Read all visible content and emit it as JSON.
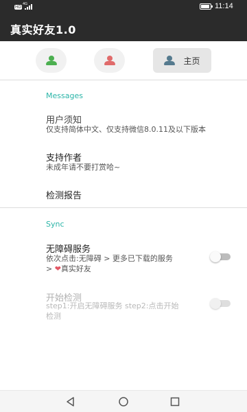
{
  "status_bar": {
    "network_badge": "HD",
    "network_type": "4G",
    "time": "11:14",
    "battery_level": 0.9
  },
  "app_bar": {
    "title": "真实好友1.0"
  },
  "tabs": [
    {
      "icon": "person-icon",
      "color": "#4caf50",
      "label": ""
    },
    {
      "icon": "person-icon",
      "color": "#e06b6b",
      "label": ""
    },
    {
      "icon": "person-icon",
      "color": "#557a8e",
      "label": "主页"
    }
  ],
  "messages_section": {
    "header": "Messages",
    "items": [
      {
        "title": "用户须知",
        "subtitle": "仅支持简体中文、仅支持微信8.0.11及以下版本"
      },
      {
        "title": "支持作者",
        "subtitle": "未成年请不要打赏哈~"
      },
      {
        "title": "检测报告",
        "subtitle": ""
      }
    ]
  },
  "sync_section": {
    "header": "Sync",
    "items": [
      {
        "title": "无障碍服务",
        "subtitle_line1": "依次点击:无障碍 > 更多已下载的服务",
        "subtitle_line2_prefix": ">",
        "subtitle_line2_suffix": "真实好友",
        "toggle_on": false,
        "enabled": true
      },
      {
        "title": "开始检测",
        "subtitle_line1": "step1:开启无障碍服务 step2:点击开始",
        "subtitle_line2": "检测",
        "toggle_on": false,
        "enabled": false
      }
    ]
  },
  "colors": {
    "app_bar_bg": "#2b2b2b",
    "section_accent": "#2bb5a8",
    "heart": "#e25563"
  },
  "nav_bar": {
    "back": "back-icon",
    "home": "home-icon",
    "recents": "recents-icon"
  }
}
